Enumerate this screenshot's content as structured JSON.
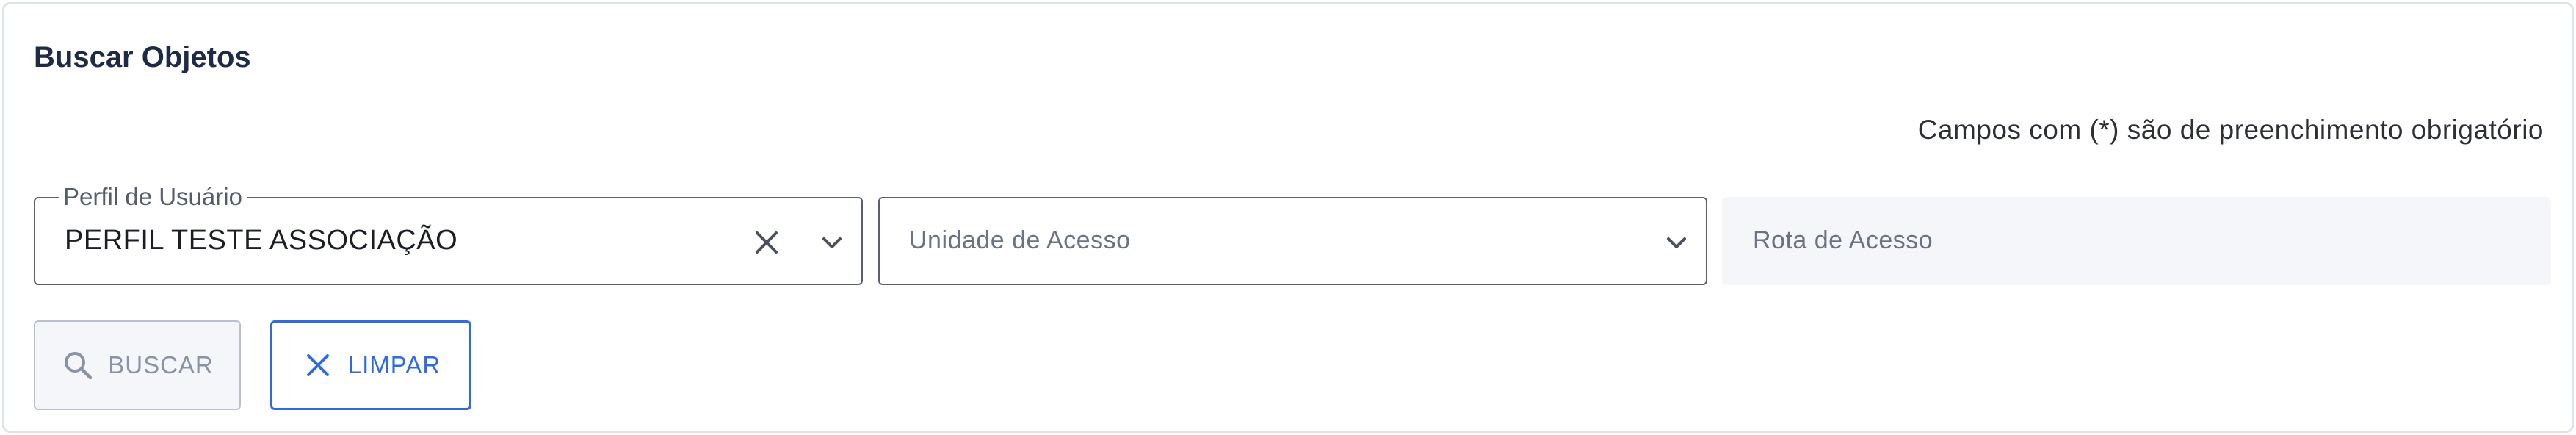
{
  "page": {
    "title": "Buscar Objetos",
    "required_note": "Campos com (*) são de preenchimento obrigatório"
  },
  "filters": {
    "profile": {
      "label": "Perfil de Usuário",
      "value": "PERFIL TESTE ASSOCIAÇÃO"
    },
    "unit": {
      "placeholder": "Unidade de Acesso"
    },
    "route": {
      "placeholder": "Rota de Acesso"
    }
  },
  "actions": {
    "search_label": "BUSCAR",
    "clear_label": "LIMPAR"
  },
  "icons": {
    "clear": "close-icon",
    "dropdown": "chevron-down-icon",
    "search": "search-icon"
  },
  "colors": {
    "accent": "#2f6bdc",
    "title": "#1f2a44",
    "disabled_bg": "#f4f6fa",
    "border": "#5a6070"
  }
}
